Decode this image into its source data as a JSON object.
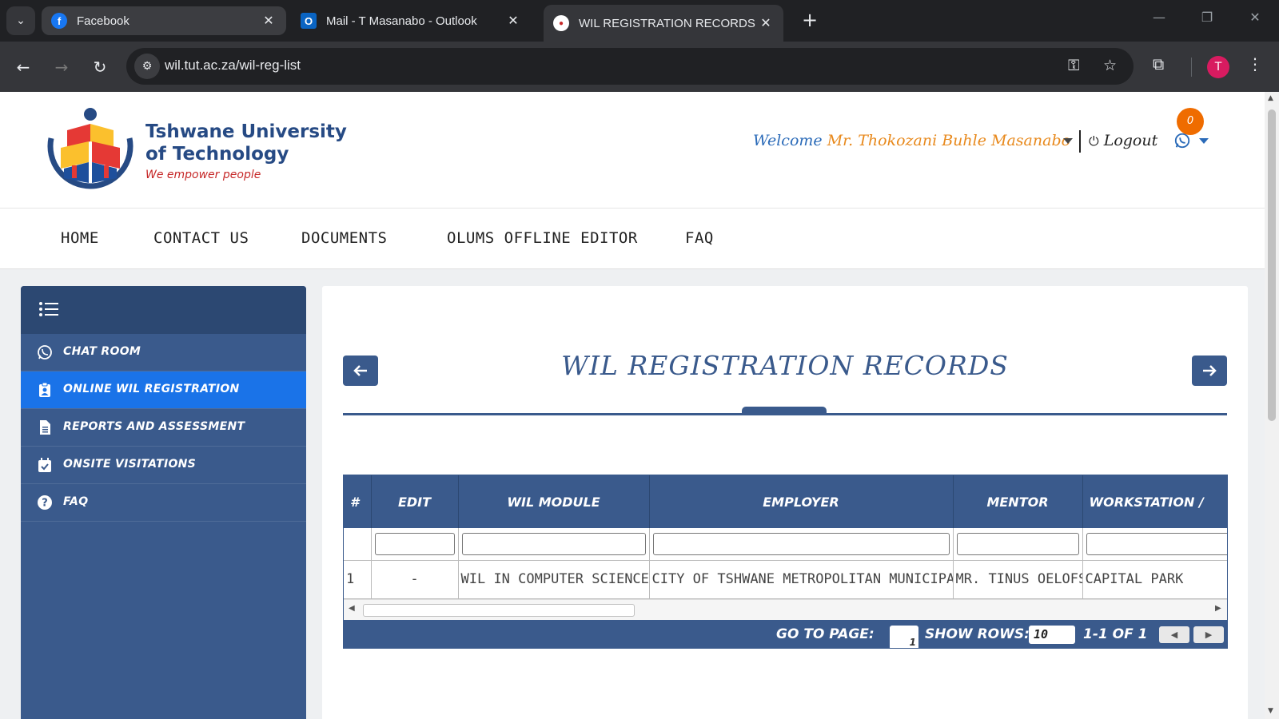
{
  "browser": {
    "tabs": [
      {
        "title": "Facebook",
        "favicon": "facebook-icon"
      },
      {
        "title": "Mail - T Masanabo - Outlook",
        "favicon": "outlook-icon"
      },
      {
        "title": "WIL REGISTRATION RECORDS :: W",
        "favicon": "tut-icon",
        "active": true
      }
    ],
    "url": "wil.tut.ac.za/wil-reg-list",
    "profile_initial": "T",
    "accent": "#d81b60"
  },
  "header": {
    "brand_line1": "Tshwane University",
    "brand_line2": "of Technology",
    "tagline": "We empower people",
    "welcome_label": "Welcome",
    "user_name": "Mr. Thokozani Buhle Masanabo",
    "logout_label": "Logout",
    "notification_count": "0"
  },
  "nav": {
    "items": [
      "HOME",
      "CONTACT US",
      "DOCUMENTS",
      "OLUMS OFFLINE EDITOR",
      "FAQ"
    ]
  },
  "sidebar": {
    "items": [
      {
        "label": "CHAT ROOM",
        "icon": "whatsapp-icon"
      },
      {
        "label": "ONLINE WIL REGISTRATION",
        "icon": "clipboard-user-icon",
        "active": true
      },
      {
        "label": "REPORTS AND ASSESSMENT",
        "icon": "file-text-icon"
      },
      {
        "label": "ONSITE VISITATIONS",
        "icon": "calendar-check-icon"
      },
      {
        "label": "FAQ",
        "icon": "question-circle-icon"
      }
    ]
  },
  "main": {
    "title": "WIL REGISTRATION RECORDS",
    "table": {
      "columns": [
        "#",
        "EDIT",
        "WIL MODULE",
        "EMPLOYER",
        "MENTOR",
        "WORKSTATION /"
      ],
      "rows": [
        [
          "1",
          "-",
          "WIL IN COMPUTER SCIENCE",
          "CITY OF TSHWANE METROPOLITAN MUNICIPALITY",
          "MR. TINUS OELOFSE",
          "CAPITAL PARK"
        ]
      ]
    },
    "pager": {
      "goto_label": "GO TO PAGE:",
      "goto_value": "1",
      "rows_label": "SHOW ROWS:",
      "rows_value": "10",
      "range_text": "1-1 OF 1"
    }
  },
  "colors": {
    "primary": "#3a5a8c",
    "active_item": "#1a73e8",
    "brand_blue": "#264a84",
    "brand_red": "#c62828",
    "user_orange": "#e8891c",
    "badge_orange": "#ef6c00"
  }
}
